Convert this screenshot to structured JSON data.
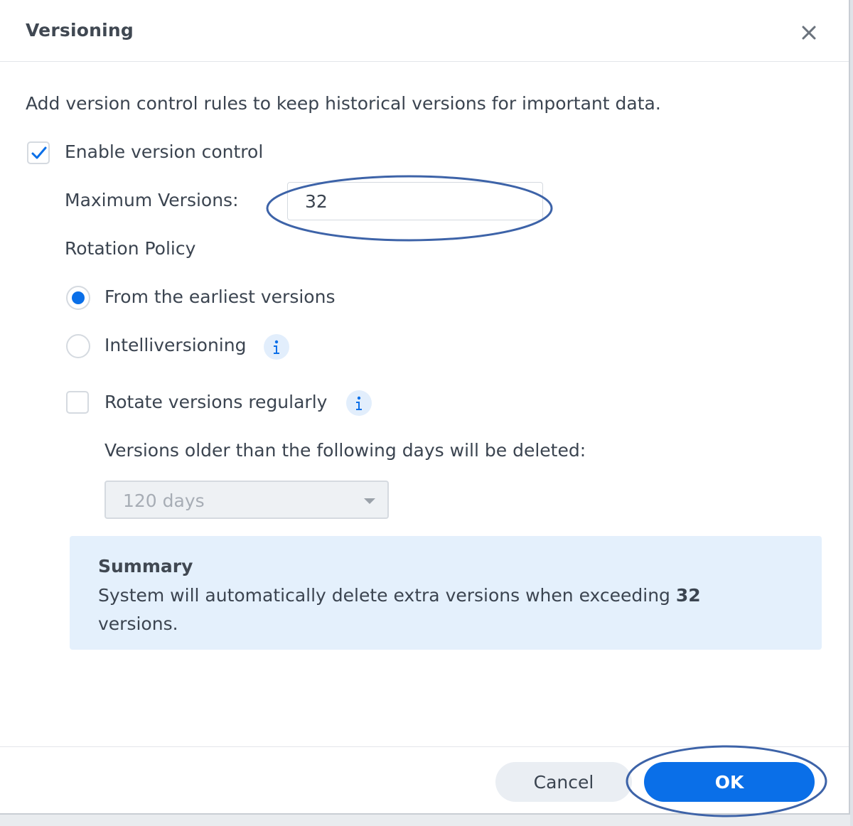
{
  "dialog": {
    "title": "Versioning",
    "description": "Add version control rules to keep historical versions for important data.",
    "enable_label": "Enable version control",
    "enable_checked": true,
    "max_versions_label": "Maximum Versions:",
    "max_versions_value": "32",
    "rotation_policy_label": "Rotation Policy",
    "policy_options": [
      {
        "label": "From the earliest versions",
        "selected": true
      },
      {
        "label": "Intelliversioning",
        "selected": false
      }
    ],
    "rotate_regularly_label": "Rotate versions regularly",
    "rotate_regularly_checked": false,
    "older_than_label": "Versions older than the following days will be deleted:",
    "days_select_value": "120 days",
    "summary": {
      "title": "Summary",
      "text_before": "System will automatically delete extra versions when exceeding ",
      "count": "32",
      "text_after": "versions."
    },
    "cancel_label": "Cancel",
    "ok_label": "OK"
  },
  "colors": {
    "accent": "#0a6fe8",
    "summary_bg": "#e4f0fc",
    "annotation": "#3d63a8"
  },
  "icons": [
    "close-icon",
    "checkmark-icon",
    "info-icon",
    "chevron-down-icon"
  ]
}
